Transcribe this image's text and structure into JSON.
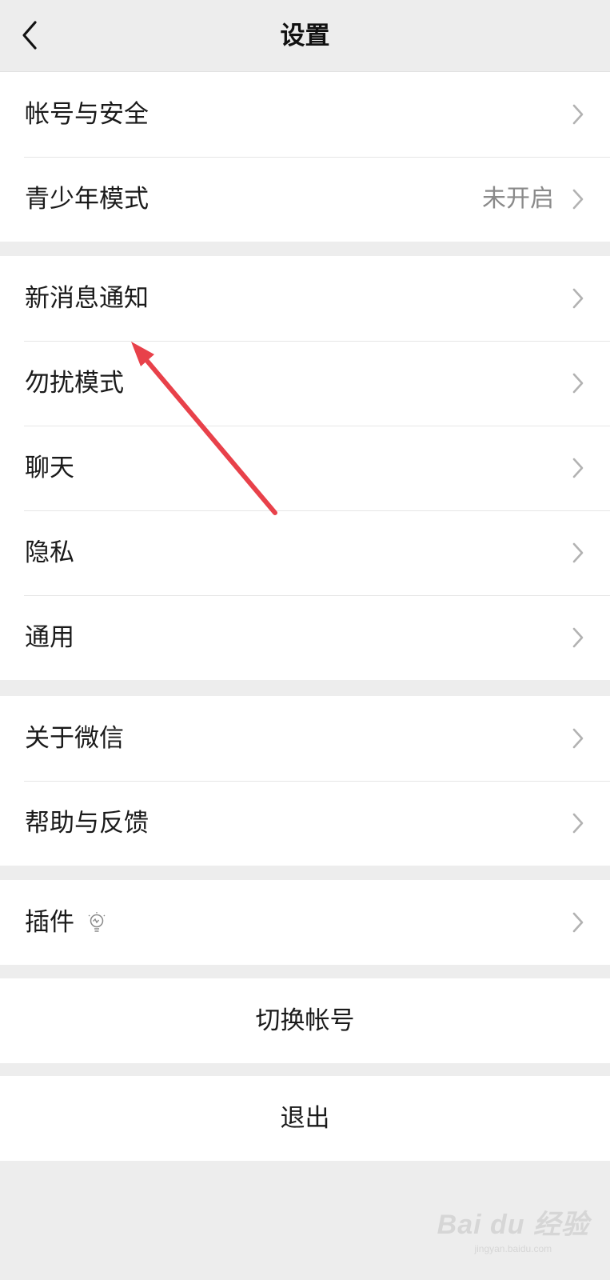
{
  "header": {
    "title": "设置"
  },
  "groups": [
    {
      "items": [
        {
          "label": "帐号与安全",
          "value": ""
        },
        {
          "label": "青少年模式",
          "value": "未开启"
        }
      ]
    },
    {
      "items": [
        {
          "label": "新消息通知"
        },
        {
          "label": "勿扰模式"
        },
        {
          "label": "聊天"
        },
        {
          "label": "隐私"
        },
        {
          "label": "通用"
        }
      ]
    },
    {
      "items": [
        {
          "label": "关于微信"
        },
        {
          "label": "帮助与反馈"
        }
      ]
    },
    {
      "items": [
        {
          "label": "插件",
          "icon": "lightbulb-icon"
        }
      ]
    }
  ],
  "actions": {
    "switch_account": "切换帐号",
    "logout": "退出"
  },
  "watermark": {
    "logo": "Bai du 经验",
    "sub": "jingyan.baidu.com"
  },
  "colors": {
    "background": "#ededed",
    "card": "#ffffff",
    "annotation_arrow": "#e8414a"
  }
}
